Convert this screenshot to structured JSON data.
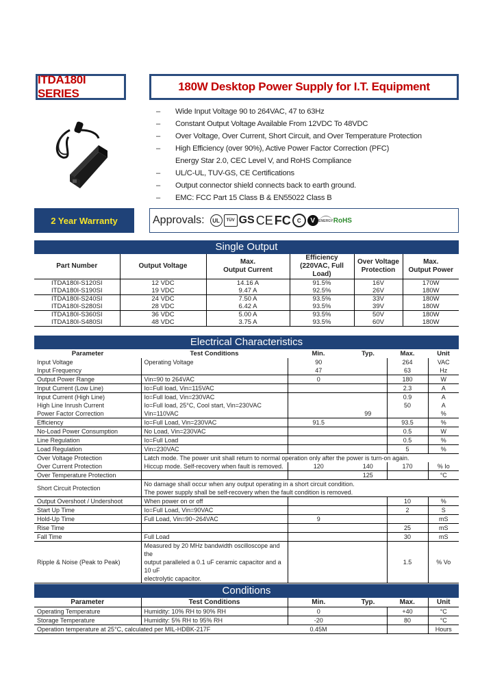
{
  "header": {
    "series": "ITDA180I SERIES",
    "title": "180W Desktop Power Supply for I.T. Equipment"
  },
  "product_image": "desktop-power-supply-adapter",
  "features": [
    {
      "bullet": "–",
      "text": "Wide Input Voltage 90 to 264VAC, 47 to 63Hz"
    },
    {
      "bullet": "–",
      "text": "Constant Output Voltage Available From 12VDC To 48VDC"
    },
    {
      "bullet": "–",
      "text": "Over Voltage, Over Current, Short Circuit, and Over Temperature Protection"
    },
    {
      "bullet": "–",
      "text": "High Efficiency (over 90%), Active Power Factor Correction (PFC)"
    },
    {
      "bullet": "",
      "text": "Energy Star 2.0, CEC Level V, and RoHS Compliance"
    },
    {
      "bullet": "–",
      "text": "UL/C-UL, TUV-GS, CE Certifications"
    },
    {
      "bullet": "–",
      "text": "Output connector shield connects back to earth ground."
    },
    {
      "bullet": "–",
      "text": "EMC: FCC Part 15 Class B & EN55022 Class B"
    }
  ],
  "warranty": "2 Year Warranty",
  "approvals": {
    "label": "Approvals:",
    "logos": [
      "UL",
      "TUV",
      "GS",
      "CE",
      "FC",
      "CCC",
      "V",
      "Energy Star",
      "RoHS"
    ]
  },
  "single_output": {
    "title": "Single Output",
    "headers": [
      "Part Number",
      "Output Voltage",
      "Max.\nOutput Current",
      "Efficiency\n(220VAC, Full Load)",
      "Over Voltage\nProtection",
      "Max.\nOutput Power"
    ],
    "rows": [
      [
        "ITDA180I-S120SI",
        "12 VDC",
        "14.16 A",
        "91.5%",
        "16V",
        "170W"
      ],
      [
        "ITDA180I-S190SI",
        "19 VDC",
        "9.47 A",
        "92.5%",
        "26V",
        "180W"
      ],
      [
        "ITDA180I-S240SI",
        "24 VDC",
        "7.50 A",
        "93.5%",
        "33V",
        "180W"
      ],
      [
        "ITDA180I-S280SI",
        "28 VDC",
        "6.42 A",
        "93.5%",
        "39V",
        "180W"
      ],
      [
        "ITDA180I-S360SI",
        "36 VDC",
        "5.00 A",
        "93.5%",
        "50V",
        "180W"
      ],
      [
        "ITDA180I-S480SI",
        "48 VDC",
        "3.75 A",
        "93.5%",
        "60V",
        "180W"
      ]
    ]
  },
  "electrical": {
    "title": "Electrical Characteristics",
    "headers": [
      "Parameter",
      "Test Conditions",
      "Min.",
      "Typ.",
      "Max.",
      "Unit"
    ],
    "rows": [
      {
        "param": "Input Voltage",
        "cond": "Operating Voltage",
        "min": "90",
        "typ": "",
        "max": "264",
        "unit": "VAC"
      },
      {
        "param": "Input Frequency",
        "cond": "",
        "min": "47",
        "typ": "",
        "max": "63",
        "unit": "Hz"
      },
      {
        "param": "Output Power Range",
        "cond": "Vin=90 to 264VAC",
        "min": "0",
        "typ": "",
        "max": "180",
        "unit": "W"
      },
      {
        "param": "Input Current (Low Line)",
        "cond": "Io=Full load, Vin=115VAC",
        "min": "",
        "typ": "",
        "max": "2.3",
        "unit": "A"
      },
      {
        "param": "Input Current (High Line)",
        "cond": "Io=Full load, Vin=230VAC",
        "min": "",
        "typ": "",
        "max": "0.9",
        "unit": "A"
      },
      {
        "param": "High Line Inrush Current",
        "cond": "Io=Full load, 25°C, Cool start, Vin=230VAC",
        "min": "",
        "typ": "",
        "max": "50",
        "unit": "A"
      },
      {
        "param": "Power Factor Correction",
        "cond": "Vin=110VAC",
        "min": "",
        "typ": "99",
        "max": "",
        "unit": "%"
      },
      {
        "param": "Efficiency",
        "cond": "Io=Full Load, Vin=230VAC",
        "min": "91.5",
        "typ": "",
        "max": "93.5",
        "unit": "%"
      },
      {
        "param": "No-Load Power Consumption",
        "cond": "No Load, Vin=230VAC",
        "min": "",
        "typ": "",
        "max": "0.5",
        "unit": "W"
      },
      {
        "param": "Line Regulation",
        "cond": "Io=Full Load",
        "min": "",
        "typ": "",
        "max": "0.5",
        "unit": "%"
      },
      {
        "param": "Load Regulation",
        "cond": "Vin=230VAC",
        "min": "",
        "typ": "",
        "max": "5",
        "unit": "%"
      },
      {
        "param": "Over Voltage Protection",
        "cond": "Latch mode. The power unit shall return to normal operation only after the power is turn-on again.",
        "min": "",
        "typ": "",
        "max": "",
        "unit": ""
      },
      {
        "param": "Over Current Protection",
        "cond": "Hiccup mode. Self-recovery when fault    is removed.",
        "min": "120",
        "typ": "140",
        "max": "170",
        "unit": "% Io"
      },
      {
        "param": "Over Temperature Protection",
        "cond": "",
        "min": "",
        "typ": "125",
        "max": "",
        "unit": "°C"
      },
      {
        "param": "Short Circuit Protection",
        "cond": "No damage shall occur when any output operating in a short circuit condition.\nThe power supply shall be self-recovery when the fault condition is removed.",
        "min": "",
        "typ": "",
        "max": "",
        "unit": ""
      },
      {
        "param": "Output Overshoot / Undershoot",
        "cond": "When power on or off",
        "min": "",
        "typ": "",
        "max": "10",
        "unit": "%"
      },
      {
        "param": "Start Up Time",
        "cond": "Io=Full Load, Vin=90VAC",
        "min": "",
        "typ": "",
        "max": "2",
        "unit": "S"
      },
      {
        "param": "Hold-Up Time",
        "cond": "Full Load, Vin=90~264VAC",
        "min": "9",
        "typ": "",
        "max": "",
        "unit": "mS"
      },
      {
        "param": "Rise Time",
        "cond": "",
        "min": "",
        "typ": "",
        "max": "25",
        "unit": "mS"
      },
      {
        "param": "Fall Time",
        "cond": "Full Load",
        "min": "",
        "typ": "",
        "max": "30",
        "unit": "mS"
      },
      {
        "param": "Ripple & Noise (Peak to Peak)",
        "cond": "Measured by 20 MHz bandwidth oscilloscope and the\noutput paralleled a 0.1 uF ceramic capacitor and a 10 uF\nelectrolytic capacitor.",
        "min": "",
        "typ": "",
        "max": "1.5",
        "unit": "% Vo"
      }
    ]
  },
  "conditions": {
    "title": "Conditions",
    "headers": [
      "Parameter",
      "Test Conditions",
      "Min.",
      "Typ.",
      "Max.",
      "Unit"
    ],
    "rows": [
      {
        "param": "Operating Temperature",
        "cond": "Humidity: 10% RH to 90% RH",
        "min": "0",
        "typ": "",
        "max": "+40",
        "unit": "°C"
      },
      {
        "param": "Storage Temperature",
        "cond": "Humidity: 5% RH to 95% RH",
        "min": "-20",
        "typ": "",
        "max": "80",
        "unit": "°C"
      },
      {
        "param": "Operation temperature at 25°C, calculated per MIL-HDBK-217F",
        "cond": "",
        "min": "0.45M",
        "typ": "",
        "max": "",
        "unit": "Hours"
      }
    ]
  }
}
